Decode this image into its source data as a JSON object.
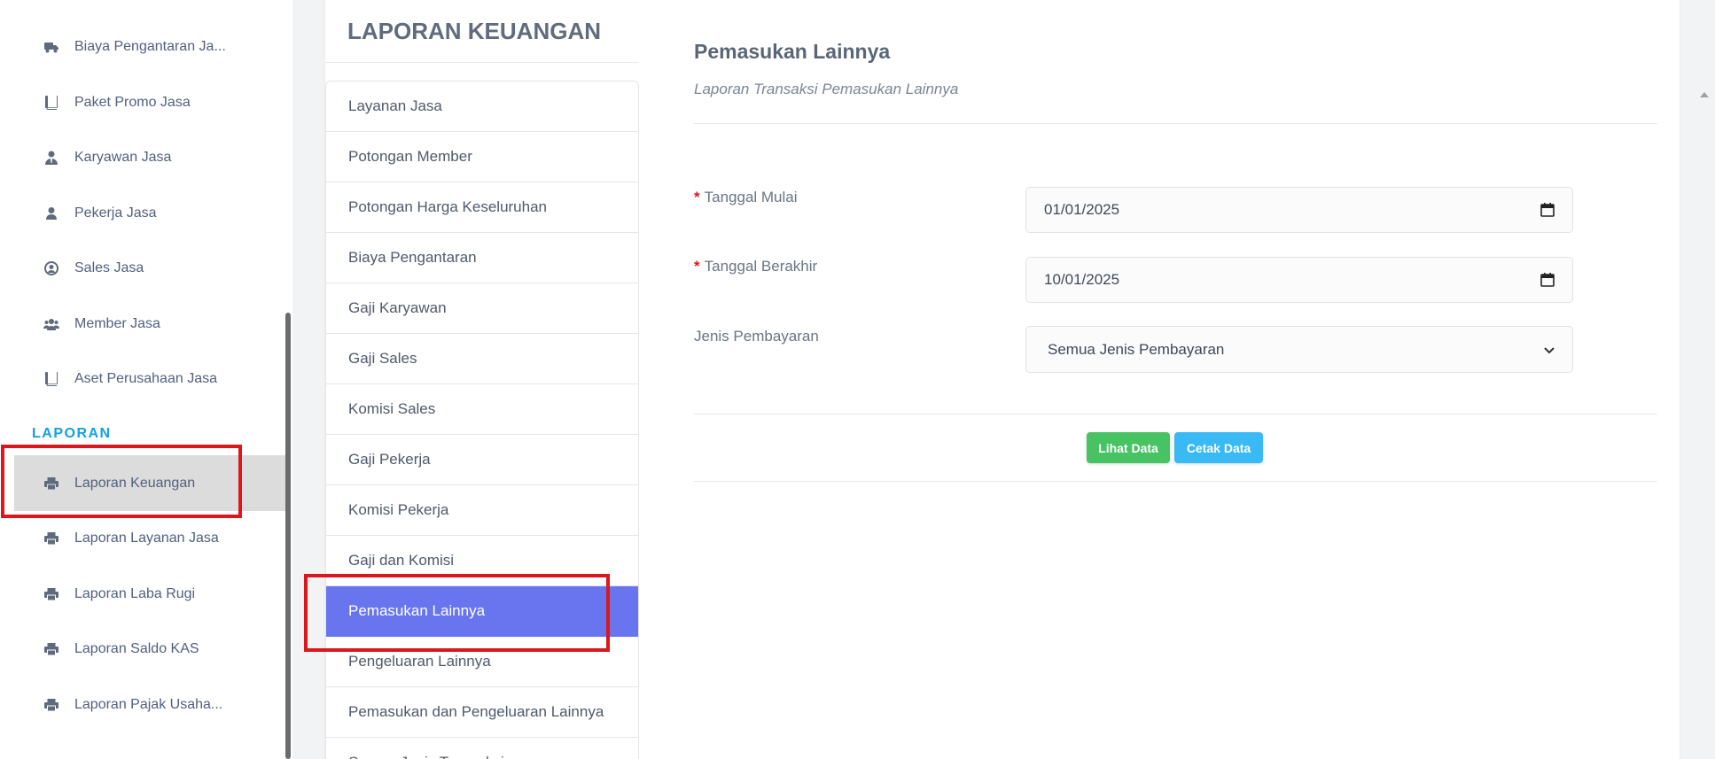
{
  "sidebar": {
    "items": [
      {
        "label": "Biaya Pengantaran Ja...",
        "icon": "truck-icon"
      },
      {
        "label": "Paket Promo Jasa",
        "icon": "book-icon"
      },
      {
        "label": "Karyawan Jasa",
        "icon": "user-tie-icon"
      },
      {
        "label": "Pekerja Jasa",
        "icon": "user-icon"
      },
      {
        "label": "Sales Jasa",
        "icon": "user-circle-icon"
      },
      {
        "label": "Member Jasa",
        "icon": "users-icon"
      },
      {
        "label": "Aset Perusahaan Jasa",
        "icon": "book-icon"
      }
    ],
    "section_label": "LAPORAN",
    "report_items": [
      {
        "label": "Laporan Keuangan",
        "icon": "print-icon",
        "active": true
      },
      {
        "label": "Laporan Layanan Jasa",
        "icon": "print-icon"
      },
      {
        "label": "Laporan Laba Rugi",
        "icon": "print-icon"
      },
      {
        "label": "Laporan Saldo KAS",
        "icon": "print-icon"
      },
      {
        "label": "Laporan Pajak Usaha...",
        "icon": "print-icon"
      }
    ]
  },
  "report_menu": {
    "title": "LAPORAN KEUANGAN",
    "items": [
      {
        "label": "Layanan Jasa"
      },
      {
        "label": "Potongan Member"
      },
      {
        "label": "Potongan Harga Keseluruhan"
      },
      {
        "label": "Biaya Pengantaran"
      },
      {
        "label": "Gaji Karyawan"
      },
      {
        "label": "Gaji Sales"
      },
      {
        "label": "Komisi Sales"
      },
      {
        "label": "Gaji Pekerja"
      },
      {
        "label": "Komisi Pekerja"
      },
      {
        "label": "Gaji dan Komisi"
      },
      {
        "label": "Pemasukan Lainnya",
        "active": true
      },
      {
        "label": "Pengeluaran Lainnya"
      },
      {
        "label": "Pemasukan dan Pengeluaran Lainnya"
      },
      {
        "label": "Semua Jenis Transaksi"
      }
    ]
  },
  "form": {
    "title": "Pemasukan Lainnya",
    "subtitle": "Laporan Transaksi Pemasukan Lainnya",
    "start_date": {
      "label": "Tanggal Mulai",
      "required_mark": "*",
      "value": "01/01/2025"
    },
    "end_date": {
      "label": "Tanggal Berakhir",
      "required_mark": "*",
      "value": "10/01/2025"
    },
    "payment_type": {
      "label": "Jenis Pembayaran",
      "value": "Semua Jenis Pembayaran"
    },
    "view_button": "Lihat Data",
    "print_button": "Cetak Data"
  },
  "colors": {
    "accent": "#6875ef",
    "section": "#11a0e6",
    "highlight": "#d9171d",
    "green_button": "#47c363",
    "blue_button": "#3abaf4"
  }
}
